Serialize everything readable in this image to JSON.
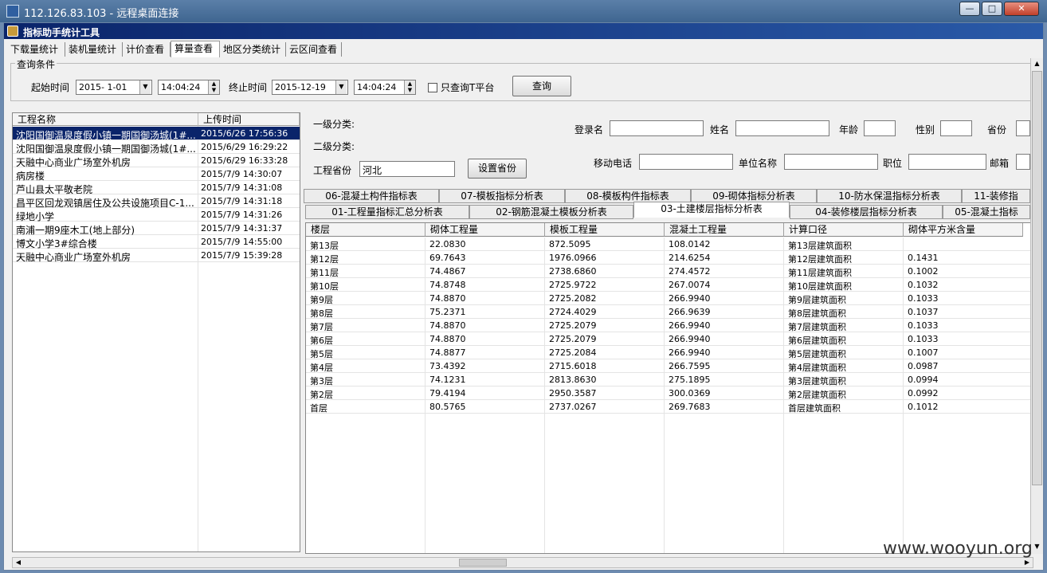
{
  "window": {
    "title": "112.126.83.103 - 远程桌面连接"
  },
  "app": {
    "title": "指标助手统计工具"
  },
  "menu_tabs": [
    "下载量统计",
    "装机量统计",
    "计价查看",
    "算量查看",
    "地区分类统计",
    "云区间查看"
  ],
  "active_menu_tab": "算量查看",
  "query": {
    "group_label": "查询条件",
    "start_label": "起始时间",
    "start_date": "2015- 1-01",
    "start_time": "14:04:24",
    "end_label": "终止时间",
    "end_date": "2015-12-19",
    "end_time": "14:04:24",
    "checkbox_label": "只查询T平台",
    "query_button": "查询"
  },
  "project_list": {
    "columns": [
      "工程名称",
      "上传时间"
    ],
    "rows": [
      {
        "name": "沈阳国御温泉度假小镇一期国御汤城(1#...",
        "time": "2015/6/26 17:56:36"
      },
      {
        "name": "沈阳国御温泉度假小镇一期国御汤城(1#...",
        "time": "2015/6/29 16:29:22"
      },
      {
        "name": "天融中心商业广场室外机房",
        "time": "2015/6/29 16:33:28"
      },
      {
        "name": "病房楼",
        "time": "2015/7/9 14:30:07"
      },
      {
        "name": "芦山县太平敬老院",
        "time": "2015/7/9 14:31:08"
      },
      {
        "name": "昌平区回龙观镇居住及公共设施项目C-1...",
        "time": "2015/7/9 14:31:18"
      },
      {
        "name": "绿地小学",
        "time": "2015/7/9 14:31:26"
      },
      {
        "name": "南浦一期9座木工(地上部分)",
        "time": "2015/7/9 14:31:37"
      },
      {
        "name": "博文小学3#综合楼",
        "time": "2015/7/9 14:55:00"
      },
      {
        "name": "天融中心商业广场室外机房",
        "time": "2015/7/9 15:39:28"
      }
    ]
  },
  "filters": {
    "level1_label": "一级分类:",
    "level2_label": "二级分类:",
    "province_label": "工程省份",
    "province_value": "河北",
    "set_province_button": "设置省份",
    "login_label": "登录名",
    "name_label": "姓名",
    "age_label": "年龄",
    "gender_label": "性别",
    "prov_label": "省份",
    "phone_label": "移动电话",
    "company_label": "单位名称",
    "position_label": "职位",
    "email_label": "邮箱"
  },
  "analysis_tabs_row1": [
    "06-混凝土构件指标表",
    "07-模板指标分析表",
    "08-模板构件指标表",
    "09-砌体指标分析表",
    "10-防水保温指标分析表",
    "11-装修指"
  ],
  "analysis_tabs_row2": [
    "01-工程量指标汇总分析表",
    "02-钢筋混凝土模板分析表",
    "03-土建楼层指标分析表",
    "04-装修楼层指标分析表",
    "05-混凝土指标"
  ],
  "grid": {
    "columns": [
      "楼层",
      "砌体工程量",
      "模板工程量",
      "混凝土工程量",
      "计算口径",
      "砌体平方米含量"
    ],
    "rows": [
      [
        "第13层",
        "22.0830",
        "872.5095",
        "108.0142",
        "第13层建筑面积",
        ""
      ],
      [
        "第12层",
        "69.7643",
        "1976.0966",
        "214.6254",
        "第12层建筑面积",
        "0.1431"
      ],
      [
        "第11层",
        "74.4867",
        "2738.6860",
        "274.4572",
        "第11层建筑面积",
        "0.1002"
      ],
      [
        "第10层",
        "74.8748",
        "2725.9722",
        "267.0074",
        "第10层建筑面积",
        "0.1032"
      ],
      [
        "第9层",
        "74.8870",
        "2725.2082",
        "266.9940",
        "第9层建筑面积",
        "0.1033"
      ],
      [
        "第8层",
        "75.2371",
        "2724.4029",
        "266.9639",
        "第8层建筑面积",
        "0.1037"
      ],
      [
        "第7层",
        "74.8870",
        "2725.2079",
        "266.9940",
        "第7层建筑面积",
        "0.1033"
      ],
      [
        "第6层",
        "74.8870",
        "2725.2079",
        "266.9940",
        "第6层建筑面积",
        "0.1033"
      ],
      [
        "第5层",
        "74.8877",
        "2725.2084",
        "266.9940",
        "第5层建筑面积",
        "0.1007"
      ],
      [
        "第4层",
        "73.4392",
        "2715.6018",
        "266.7595",
        "第4层建筑面积",
        "0.0987"
      ],
      [
        "第3层",
        "74.1231",
        "2813.8630",
        "275.1895",
        "第3层建筑面积",
        "0.0994"
      ],
      [
        "第2层",
        "79.4194",
        "2950.3587",
        "300.0369",
        "第2层建筑面积",
        "0.0992"
      ],
      [
        "首层",
        "80.5765",
        "2737.0267",
        "269.7683",
        "首层建筑面积",
        "0.1012"
      ]
    ]
  },
  "watermark": "www.wooyun.org"
}
